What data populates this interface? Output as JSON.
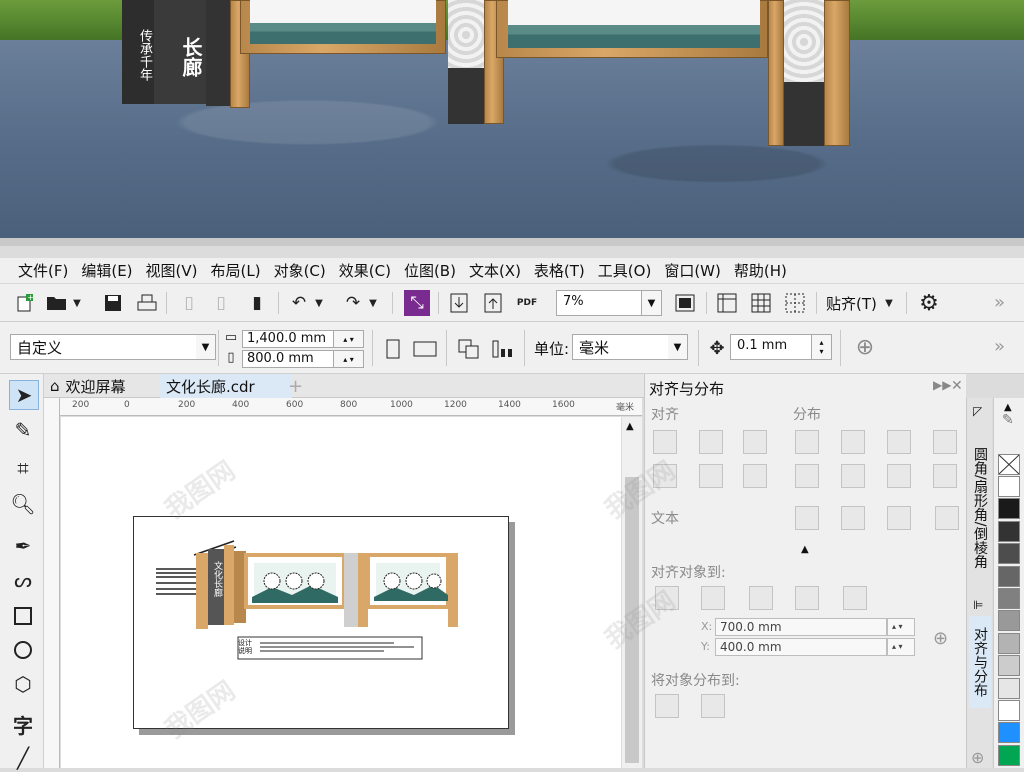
{
  "scene": {
    "sign_vertical_text": "传承千年",
    "sign_title_text": "长廊"
  },
  "menubar": {
    "items": [
      "文件(F)",
      "编辑(E)",
      "视图(V)",
      "布局(L)",
      "对象(C)",
      "效果(C)",
      "位图(B)",
      "文本(X)",
      "表格(T)",
      "工具(O)",
      "窗口(W)",
      "帮助(H)"
    ]
  },
  "toolbar1": {
    "zoom_value": "7%",
    "snap_label": "贴齐(T)",
    "overflow": "»"
  },
  "toolbar2": {
    "page_size_value": "自定义",
    "width_value": "1,400.0 mm",
    "height_value": "800.0 mm",
    "unit_label": "单位:",
    "unit_value": "毫米",
    "nudge_value": "0.1 mm",
    "overflow": "»"
  },
  "tabs": {
    "welcome": "欢迎屏幕",
    "document": "文化长廊.cdr",
    "add": "+"
  },
  "ruler": {
    "h_labels": [
      "200",
      "0",
      "200",
      "400",
      "600",
      "800",
      "1000",
      "1200",
      "1400",
      "1600"
    ],
    "unit": "毫米"
  },
  "artwork": {
    "sign_text": "文化长廊",
    "caption_text": "设计说明"
  },
  "docker": {
    "title": "对齐与分布",
    "section_align": "对齐",
    "section_distribute": "分布",
    "section_text": "文本",
    "align_to_label": "对齐对象到:",
    "x_value": "700.0 mm",
    "y_value": "400.0 mm",
    "x_prefix": "X:",
    "y_prefix": "Y:",
    "distribute_to_label": "将对象分布到:"
  },
  "docker_tabs": {
    "tab1": "圆角/扇形角/倒棱角",
    "tab2": "对齐与分布"
  },
  "palette": {
    "colors": [
      "#ffffff",
      "#1a1a1a",
      "#333333",
      "#4d4d4d",
      "#666666",
      "#808080",
      "#999999",
      "#b3b3b3",
      "#cccccc",
      "#e6e6e6",
      "#ffffff",
      "#1e90ff",
      "#00a651"
    ]
  },
  "watermark": "我图网"
}
